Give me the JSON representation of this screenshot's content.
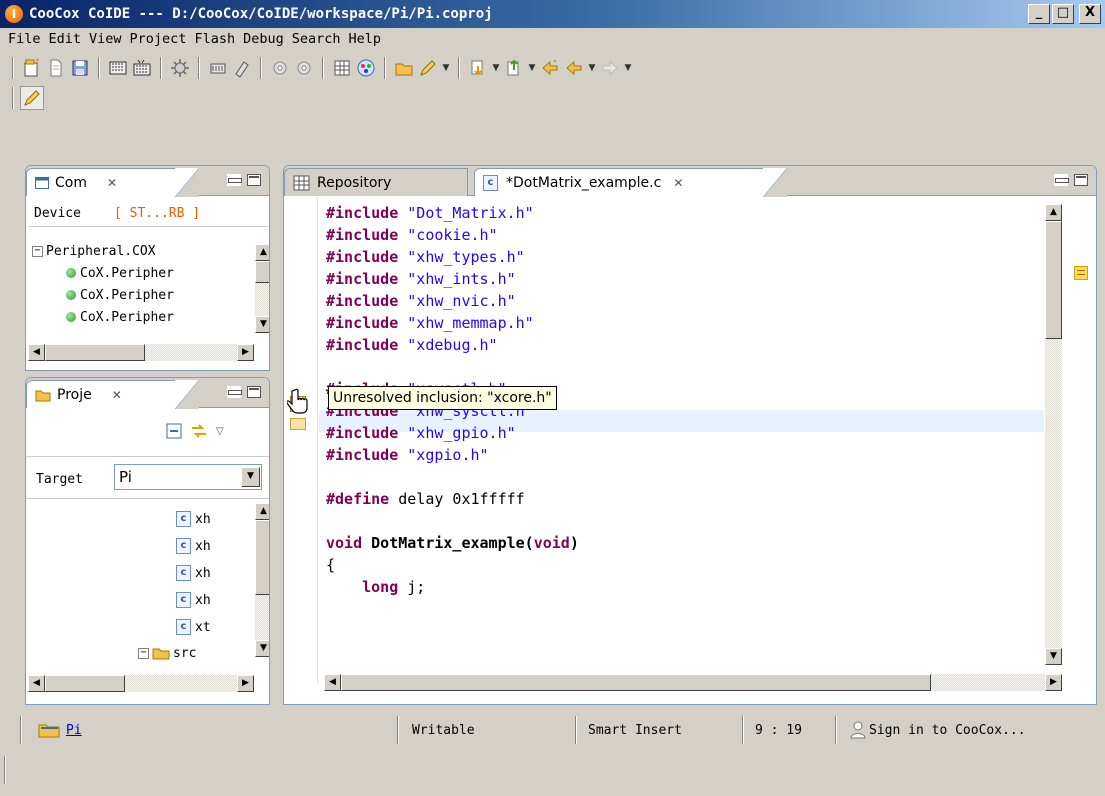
{
  "window": {
    "title": "CooCox CoIDE --- D:/CooCox/CoIDE/workspace/Pi/Pi.coproj",
    "logo_letter": "I",
    "min_label": "_",
    "max_label": "□",
    "close_label": "X"
  },
  "menu": [
    "File",
    "Edit",
    "View",
    "Project",
    "Flash",
    "Debug",
    "Search",
    "Help"
  ],
  "components_panel": {
    "tab_label": "Com",
    "device_label": "Device",
    "device_value": "[ ST...RB ]",
    "tree_root": "Peripheral.COX",
    "tree_items": [
      "CoX.Peripher",
      "CoX.Peripher",
      "CoX.Peripher"
    ]
  },
  "project_panel": {
    "tab_label": "Proje",
    "target_label": "Target",
    "target_value": "Pi",
    "files": [
      "xh",
      "xh",
      "xh",
      "xh",
      "xt"
    ],
    "folder": "src"
  },
  "editor": {
    "tabs": [
      {
        "label": "Repository"
      },
      {
        "label": "*DotMatrix_example.c"
      }
    ],
    "tooltip": "Unresolved inclusion: \"xcore.h\"",
    "code": [
      {
        "kw": "#include",
        "rest": " ",
        "str": "\"Dot_Matrix.h\""
      },
      {
        "kw": "#include",
        "rest": " ",
        "str": "\"cookie.h\""
      },
      {
        "kw": "#include",
        "rest": " ",
        "str": "\"xhw_types.h\""
      },
      {
        "kw": "#include",
        "rest": " ",
        "str": "\"xhw_ints.h\""
      },
      {
        "kw": "#include",
        "rest": " ",
        "str": "\"xhw_nvic.h\""
      },
      {
        "kw": "#include",
        "rest": " ",
        "str": "\"xhw_memmap.h\""
      },
      {
        "kw": "#include",
        "rest": " ",
        "str": "\"xdebug.h\""
      },
      {
        "kw": "",
        "rest": "",
        "str": ""
      },
      {
        "kw": "#include",
        "rest": " ",
        "str": "\"xsysctl.h\""
      },
      {
        "kw": "#include",
        "rest": " ",
        "str": "\"xhw_sysctl.h\""
      },
      {
        "kw": "#include",
        "rest": " ",
        "str": "\"xhw_gpio.h\""
      },
      {
        "kw": "#include",
        "rest": " ",
        "str": "\"xgpio.h\""
      },
      {
        "kw": "",
        "rest": "",
        "str": ""
      },
      {
        "kw": "#define",
        "rest": " delay 0x1fffff",
        "str": ""
      },
      {
        "kw": "",
        "rest": "",
        "str": ""
      },
      {
        "kw": "void",
        "rest": " DotMatrix_example(",
        "str": "",
        "kw2": "void",
        "tail": ")"
      },
      {
        "kw": "",
        "rest": "{",
        "str": ""
      },
      {
        "kw": "    long",
        "rest": " j;",
        "str": ""
      }
    ]
  },
  "status": {
    "project": "Pi",
    "mode": "Writable",
    "insert": "Smart Insert",
    "position": "9 : 19",
    "signin": "Sign in to CooCox..."
  },
  "colors": {
    "keyword": "#7f0055",
    "string": "#2a00ff",
    "highlight_line": "#e8f2fe",
    "tooltip_bg": "#ffffe1"
  }
}
